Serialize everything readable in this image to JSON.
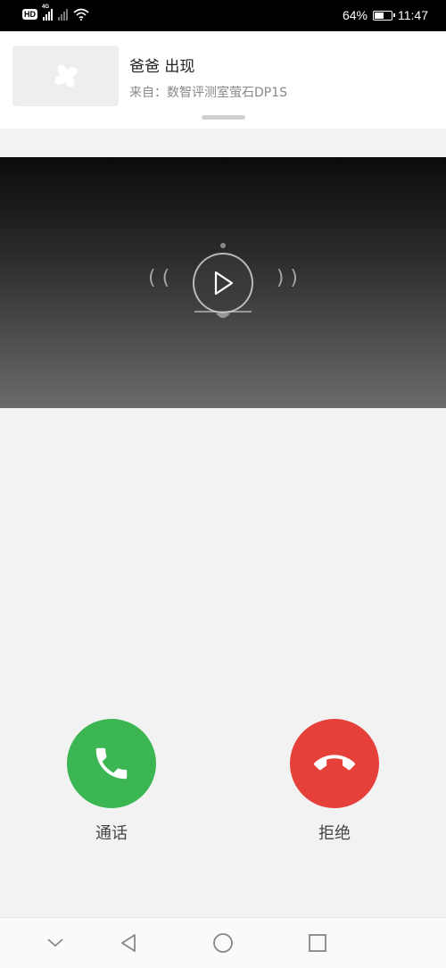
{
  "status_bar": {
    "hd_label": "HD",
    "network_label": "4G",
    "battery_percent": "64%",
    "battery_level": 0.64,
    "time": "11:47"
  },
  "notification": {
    "title": "爸爸 出现",
    "subtitle": "来自：数智评测室萤石DP1S",
    "thumbnail_icon": "fan-logo-icon"
  },
  "video": {
    "center_icon": "play-icon",
    "wave_left": "( (",
    "wave_right": ") )"
  },
  "actions": {
    "accept_label": "通话",
    "reject_label": "拒绝",
    "accept_color": "#3cb553",
    "reject_color": "#e6403a"
  },
  "nav_bar": {
    "items": [
      "collapse-icon",
      "back-icon",
      "home-icon",
      "recents-icon"
    ]
  }
}
